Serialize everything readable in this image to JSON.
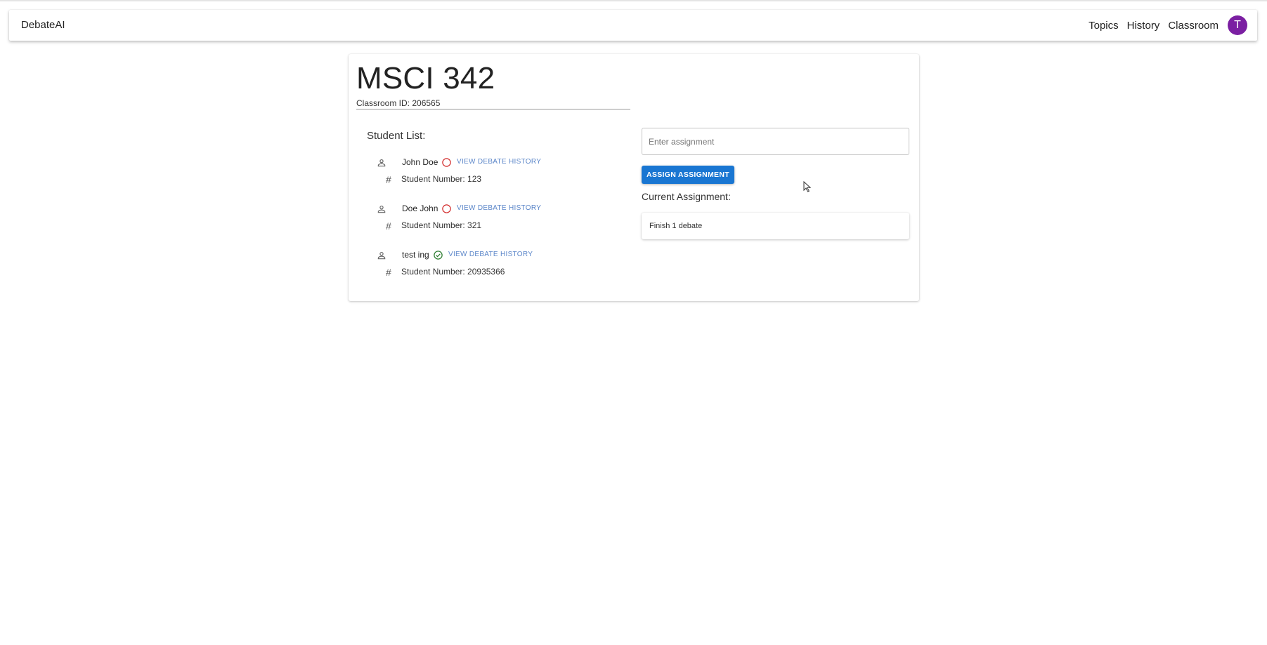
{
  "appbar": {
    "brand": "DebateAI",
    "nav": [
      "Topics",
      "History",
      "Classroom"
    ],
    "avatar_letter": "T",
    "avatar_color": "#7b1fa2"
  },
  "classroom": {
    "title": "MSCI 342",
    "id_label": "Classroom ID: 206565",
    "student_list_label": "Student List:",
    "students": [
      {
        "name": "John Doe",
        "status": "incomplete",
        "history_label": "VIEW DEBATE HISTORY",
        "number_label": "Student Number: 123"
      },
      {
        "name": "Doe John",
        "status": "incomplete",
        "history_label": "VIEW DEBATE HISTORY",
        "number_label": "Student Number: 321"
      },
      {
        "name": "test ing",
        "status": "complete",
        "history_label": "VIEW DEBATE HISTORY",
        "number_label": "Student Number: 20935366"
      }
    ]
  },
  "assignment": {
    "input_placeholder": "Enter assignment",
    "input_value": "",
    "button_label": "ASSIGN ASSIGNMENT",
    "current_label": "Current Assignment:",
    "current_value": "Finish 1 debate"
  },
  "icons": {
    "person": "person-outline-icon",
    "hash": "number-sign-icon",
    "incomplete": "empty-circle-icon",
    "complete": "check-circle-icon"
  },
  "colors": {
    "primary": "#1976d2",
    "link": "#5b86c9",
    "incomplete": "#d32f2f",
    "complete": "#2e7d32"
  }
}
